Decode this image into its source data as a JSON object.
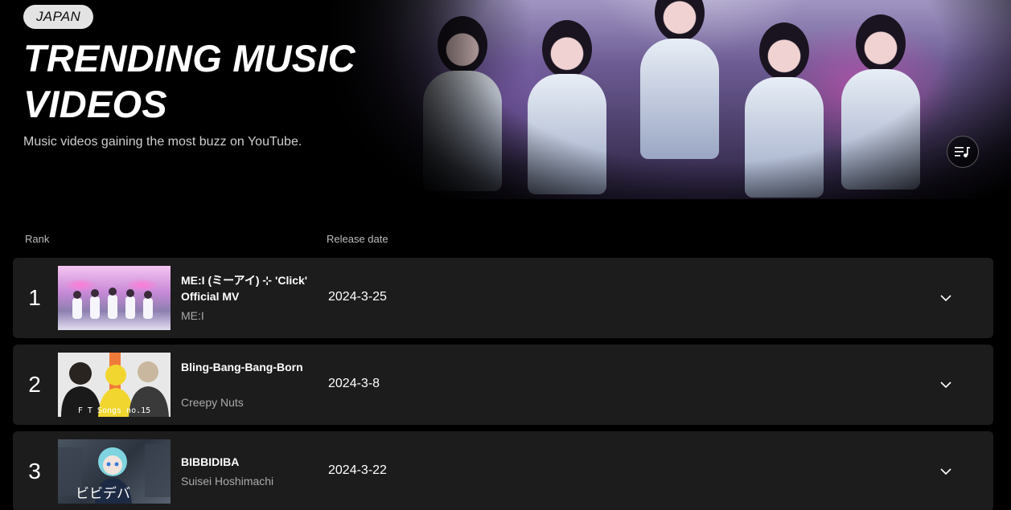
{
  "hero": {
    "country": "JAPAN",
    "title": "TRENDING MUSIC VIDEOS",
    "subtitle": "Music videos gaining the most buzz on YouTube.",
    "playlist_icon": "playlist-music-icon"
  },
  "table": {
    "headers": {
      "rank": "Rank",
      "release_date": "Release date"
    },
    "rows": [
      {
        "rank": "1",
        "title": "ME:I (ミーアイ) ⊹ 'Click' Official MV",
        "artist": "ME:I",
        "release_date": "2024-3-25",
        "thumb_caption": ""
      },
      {
        "rank": "2",
        "title": "Bling-Bang-Bang-Born",
        "artist": "Creepy Nuts",
        "release_date": "2024-3-8",
        "thumb_caption": "F T Songs no.15"
      },
      {
        "rank": "3",
        "title": "BIBBIDIBA",
        "artist": "Suisei Hoshimachi",
        "release_date": "2024-3-22",
        "thumb_caption": "ビビデバ"
      }
    ]
  },
  "colors": {
    "background": "#000000",
    "row": "#1c1c1c",
    "chip": "#e3e3e3",
    "muted": "#aaaaaa"
  }
}
